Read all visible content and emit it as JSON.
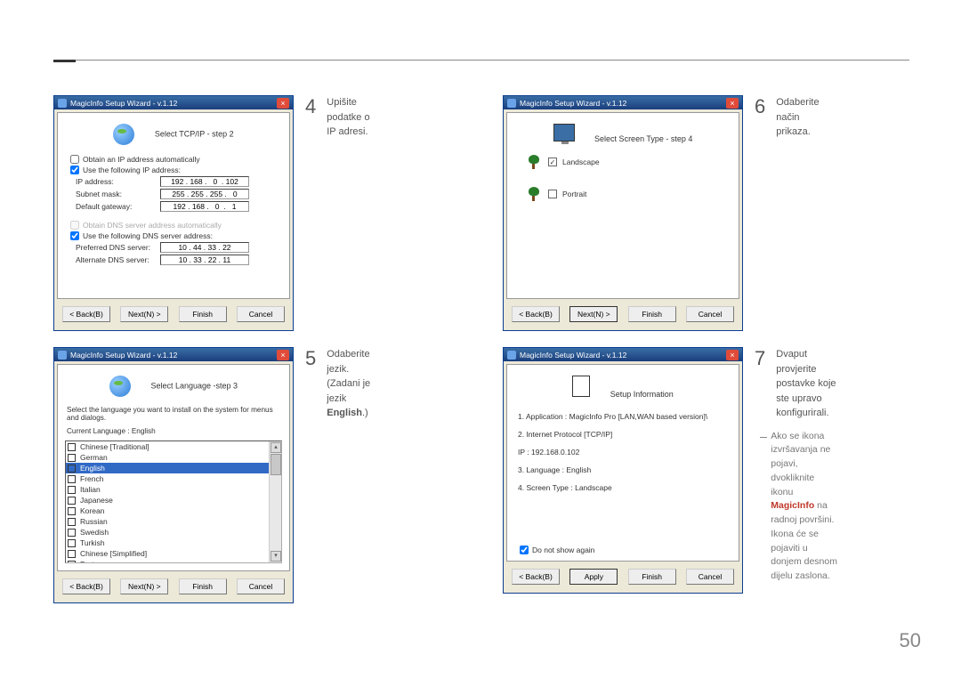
{
  "page_number": "50",
  "wizard_title": "MagicInfo Setup Wizard - v.1.12",
  "steps": {
    "s4": {
      "num": "4",
      "text": "Upišite podatke o IP adresi."
    },
    "s5": {
      "num": "5",
      "text_a": "Odaberite jezik. (Zadani je jezik ",
      "text_b": "English",
      "text_c": ".)"
    },
    "s6": {
      "num": "6",
      "text": "Odaberite način prikaza."
    },
    "s7": {
      "num": "7",
      "text_a": "Dvaput provjerite postavke koje ste upravo konfigurirali."
    }
  },
  "note": {
    "line1": "Ako se ikona izvršavanja ne pojavi, dvokliknite ikonu ",
    "magicinfo": "MagicInfo",
    "line2": " na radnoj površini. Ikona će se pojaviti u donjem desnom dijelu zaslona."
  },
  "tcpip": {
    "header": "Select TCP/IP - step 2",
    "obtain_auto": "Obtain an IP address automatically",
    "use_following": "Use the following IP address:",
    "ip_label": "IP address:",
    "ip_val": "192 . 168 .   0  . 102",
    "subnet_label": "Subnet mask:",
    "subnet_val": "255 . 255 . 255 .   0",
    "gateway_label": "Default gateway:",
    "gateway_val": "192 . 168 .   0  .   1",
    "obtain_dns_auto": "Obtain DNS server address automatically",
    "use_dns": "Use the following DNS server address:",
    "pref_dns_label": "Preferred DNS server:",
    "pref_dns_val": "10 . 44 . 33 . 22",
    "alt_dns_label": "Alternate DNS server:",
    "alt_dns_val": "10 . 33 . 22 . 11"
  },
  "lang": {
    "header": "Select Language -step 3",
    "instruction": "Select the language you want to install on the system for menus and dialogs.",
    "current_label": "Current Language     :     English",
    "items": [
      "Chinese [Traditional]",
      "German",
      "English",
      "French",
      "Italian",
      "Japanese",
      "Korean",
      "Russian",
      "Swedish",
      "Turkish",
      "Chinese [Simplified]",
      "Portuguese"
    ],
    "selected_index": 2
  },
  "screen": {
    "header": "Select Screen Type - step 4",
    "landscape": "Landscape",
    "portrait": "Portrait"
  },
  "info": {
    "header": "Setup Information",
    "l1": "1. Application   :      MagicInfo Pro [LAN,WAN based version]\\",
    "l2": "2. Internet Protocol [TCP/IP]",
    "l2b": "      IP   :      192.168.0.102",
    "l3": "3. Language  :      English",
    "l4": "4. Screen Type   :      Landscape",
    "no_show": "Do not show again"
  },
  "buttons": {
    "back": "< Back(B)",
    "next": "Next(N) >",
    "finish": "Finish",
    "cancel": "Cancel",
    "apply": "Apply"
  }
}
